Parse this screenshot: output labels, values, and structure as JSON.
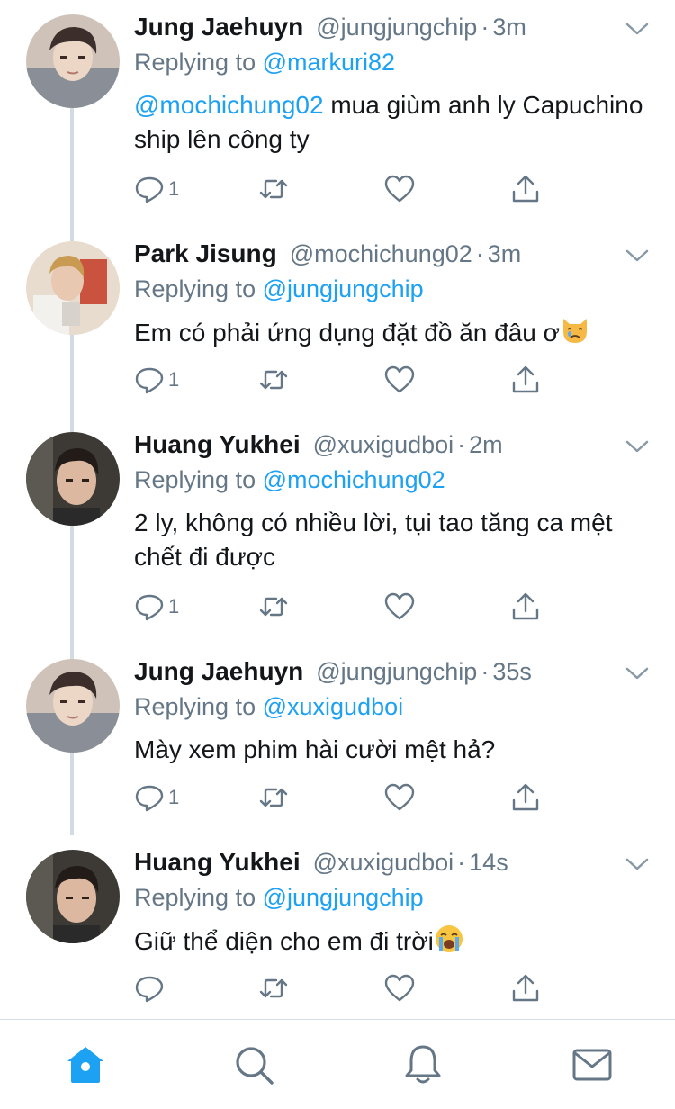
{
  "colors": {
    "accent": "#1da1f2",
    "secondary_text": "#657786",
    "thread_line": "#d3dbe1",
    "icon_gray": "#657786"
  },
  "tweets": [
    {
      "name": "Jung Jaehuyn",
      "handle": "@jungjungchip",
      "time": "3m",
      "replying_prefix": "Replying to",
      "replying_to": "@markuri82",
      "text_mention": "@mochichung02",
      "text": " mua giùm anh ly Capuchino ship lên công ty",
      "emoji": "",
      "reply_count": "1",
      "avatar": "avatar-jaehyun"
    },
    {
      "name": "Park Jisung",
      "handle": "@mochichung02",
      "time": "3m",
      "replying_prefix": "Replying to",
      "replying_to": "@jungjungchip",
      "text_mention": "",
      "text": "Em có phải ứng dụng đặt đồ ăn đâu ơ",
      "emoji": "crying-cat-emoji",
      "reply_count": "1",
      "avatar": "avatar-jisung"
    },
    {
      "name": "Huang Yukhei",
      "handle": "@xuxigudboi",
      "time": "2m",
      "replying_prefix": "Replying to",
      "replying_to": "@mochichung02",
      "text_mention": "",
      "text": "2 ly, không có nhiều lời, tụi tao tăng ca mệt chết đi được",
      "emoji": "",
      "reply_count": "1",
      "avatar": "avatar-yukhei"
    },
    {
      "name": "Jung Jaehuyn",
      "handle": "@jungjungchip",
      "time": "35s",
      "replying_prefix": "Replying to",
      "replying_to": "@xuxigudboi",
      "text_mention": "",
      "text": "Mày xem phim hài cười mệt hả?",
      "emoji": "",
      "reply_count": "1",
      "avatar": "avatar-jaehyun"
    },
    {
      "name": "Huang Yukhei",
      "handle": "@xuxigudboi",
      "time": "14s",
      "replying_prefix": "Replying to",
      "replying_to": "@jungjungchip",
      "text_mention": "",
      "text": "Giữ thể diện cho em đi trời",
      "emoji": "loudly-crying-face-emoji",
      "reply_count": "",
      "avatar": "avatar-yukhei"
    }
  ],
  "tabbar": {
    "items": [
      "home-icon",
      "search-icon",
      "notifications-bell-icon",
      "messages-mail-icon"
    ],
    "active": "home-icon"
  },
  "icons": {
    "reply": "reply-icon",
    "retweet": "retweet-icon",
    "like": "like-heart-icon",
    "share": "share-icon",
    "more": "chevron-down-icon"
  }
}
